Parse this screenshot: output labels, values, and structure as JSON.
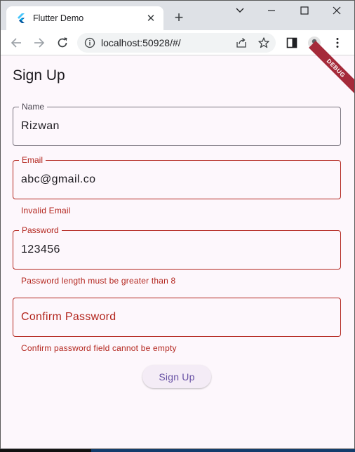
{
  "browser": {
    "tab_title": "Flutter Demo",
    "tab_close": "✕",
    "new_tab": "+",
    "url": "localhost:50928/#/",
    "window_controls": {
      "chevron": "chevron-down-icon",
      "minimize": "minimize-icon",
      "maximize": "maximize-icon",
      "close": "close-icon"
    }
  },
  "page": {
    "debug_banner": "DEBUG",
    "title": "Sign Up",
    "fields": {
      "name": {
        "label": "Name",
        "value": "Rizwan"
      },
      "email": {
        "label": "Email",
        "value": "abc@gmail.co",
        "error": "Invalid Email"
      },
      "password": {
        "label": "Password",
        "value": "123456",
        "error": "Password length must be greater than 8"
      },
      "confirm": {
        "placeholder": "Confirm Password",
        "error": "Confirm password field cannot be empty"
      }
    },
    "submit_label": "Sign Up"
  },
  "colors": {
    "error": "#b3261e",
    "primary": "#6750a4",
    "background": "#fdf7fc",
    "debug": "#a52a3a"
  }
}
